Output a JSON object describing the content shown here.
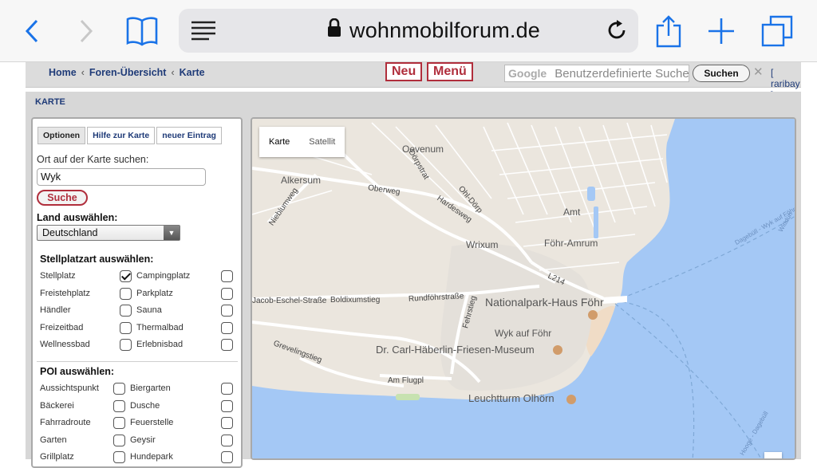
{
  "browser": {
    "domain": "wohnmobilforum.de",
    "icons": [
      "back-icon",
      "forward-icon",
      "bookmarks-icon",
      "reader-icon",
      "lock-icon",
      "reload-icon",
      "share-icon",
      "new-tab-icon",
      "tabs-icon"
    ]
  },
  "topbar": {
    "breadcrumbs": [
      "Home",
      "Foren-Übersicht",
      "Karte"
    ],
    "separator": "‹",
    "new_button": "Neu",
    "menu_button": "Menü",
    "search_logo": "Google",
    "search_placeholder": "Benutzerdefinierte Suche",
    "search_button": "Suchen",
    "clear": "✕",
    "user": "[ raribay ]"
  },
  "panel": {
    "title": "KARTE"
  },
  "sidebar": {
    "tabs": [
      {
        "label": "Optionen",
        "active": true
      },
      {
        "label": "Hilfe zur Karte",
        "active": false
      },
      {
        "label": "neuer Eintrag",
        "active": false
      }
    ],
    "search_label": "Ort auf der Karte suchen:",
    "search_value": "Wyk",
    "search_button": "Suche",
    "country_label": "Land auswählen:",
    "country_value": "Deutschland",
    "stellplatz_label": "Stellplatzart auswählen:",
    "stellplatz_items": [
      {
        "label": "Stellplatz",
        "checked": true
      },
      {
        "label": "Campingplatz",
        "checked": false
      },
      {
        "label": "Freistehplatz",
        "checked": false
      },
      {
        "label": "Parkplatz",
        "checked": false
      },
      {
        "label": "Händler",
        "checked": false
      },
      {
        "label": "Sauna",
        "checked": false
      },
      {
        "label": "Freizeitbad",
        "checked": false
      },
      {
        "label": "Thermalbad",
        "checked": false
      },
      {
        "label": "Wellnessbad",
        "checked": false
      },
      {
        "label": "Erlebnisbad",
        "checked": false
      }
    ],
    "poi_label": "POI auswählen:",
    "poi_items": [
      {
        "label": "Aussichtspunkt",
        "checked": false
      },
      {
        "label": "Biergarten",
        "checked": false
      },
      {
        "label": "Bäckerei",
        "checked": false
      },
      {
        "label": "Dusche",
        "checked": false
      },
      {
        "label": "Fahrradroute",
        "checked": false
      },
      {
        "label": "Feuerstelle",
        "checked": false
      },
      {
        "label": "Garten",
        "checked": false
      },
      {
        "label": "Geysir",
        "checked": false
      },
      {
        "label": "Grillplatz",
        "checked": false
      },
      {
        "label": "Hundepark",
        "checked": false
      }
    ]
  },
  "map": {
    "type_buttons": [
      "Karte",
      "Satellit"
    ],
    "labels": {
      "oevenum": "Oevenum",
      "alkersum": "Alkersum",
      "wrixum": "Wrixum",
      "amt": "Amt",
      "amt2": "Föhr-Amrum",
      "nationalpark": "Nationalpark-Haus Föhr",
      "wyk": "Wyk auf Föhr",
      "museum": "Dr. Carl-Häberlin-Friesen-Museum",
      "leuchtturm": "Leuchtturm Olhörn",
      "jacob": "Jacob-Eschel-Straße",
      "boldix": "Boldixumstieg",
      "rundfoehr": "Rundföhrstraße",
      "oberweg": "Oberweg",
      "hardesweg": "Hardesweg",
      "doerpstrat": "Dörpstrat",
      "ohldoerp": "Ohl-Dörp",
      "niebluemweg": "Nieblumweg",
      "l214": "L214",
      "fehrstieg": "Fehrstieg",
      "grevelingstieg": "Grevelingstieg",
      "amflugpl": "Am Flugpl",
      "dagebuell1": "Dagebüll - Wyk auf Föhr",
      "wittduen": "Wittdün",
      "hooge": "Hooge - Dagebüll"
    },
    "colors": {
      "land": "#ebe6de",
      "water": "#a4c8f5",
      "road": "#ffffff",
      "green": "#c7e2b0",
      "sand": "#f0dcc6"
    }
  }
}
